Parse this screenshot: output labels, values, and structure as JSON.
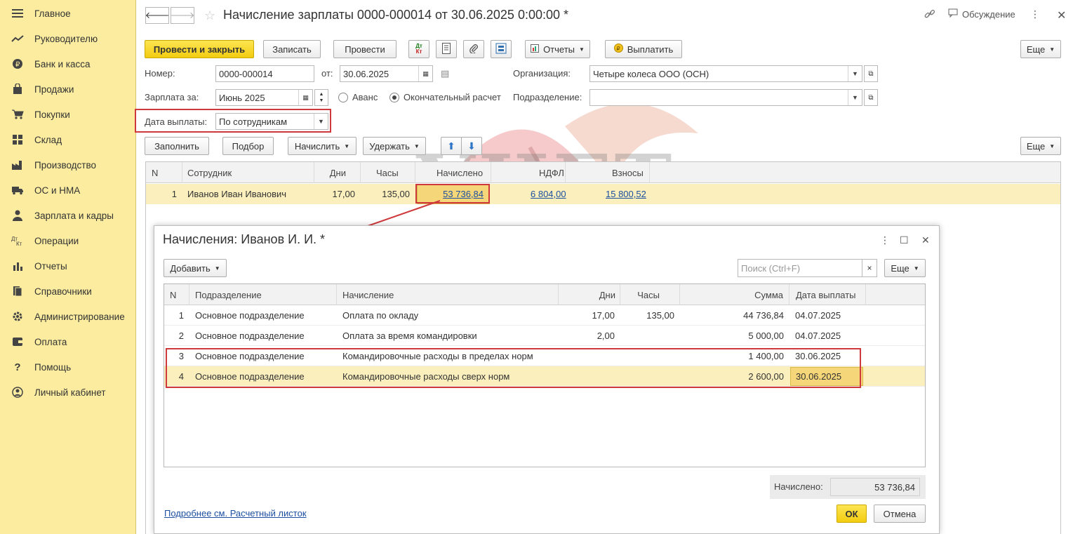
{
  "sidebar": {
    "items": [
      {
        "label": "Главное",
        "icon": "menu-icon"
      },
      {
        "label": "Руководителю",
        "icon": "trend-icon"
      },
      {
        "label": "Банк и касса",
        "icon": "coin-icon"
      },
      {
        "label": "Продажи",
        "icon": "bag-icon"
      },
      {
        "label": "Покупки",
        "icon": "cart-icon"
      },
      {
        "label": "Склад",
        "icon": "warehouse-icon"
      },
      {
        "label": "Производство",
        "icon": "factory-icon"
      },
      {
        "label": "ОС и НМА",
        "icon": "truck-icon"
      },
      {
        "label": "Зарплата и кадры",
        "icon": "person-icon"
      },
      {
        "label": "Операции",
        "icon": "dt-kt-icon"
      },
      {
        "label": "Отчеты",
        "icon": "bar-chart-icon"
      },
      {
        "label": "Справочники",
        "icon": "books-icon"
      },
      {
        "label": "Администрирование",
        "icon": "gear-icon"
      },
      {
        "label": "Оплата",
        "icon": "wallet-icon"
      },
      {
        "label": "Помощь",
        "icon": "question-icon"
      },
      {
        "label": "Личный кабинет",
        "icon": "user-circle-icon"
      }
    ]
  },
  "document": {
    "title": "Начисление зарплаты 0000-000014 от 30.06.2025 0:00:00 *",
    "discussion_label": "Обсуждение"
  },
  "toolbar": {
    "post_close": "Провести и закрыть",
    "save": "Записать",
    "post": "Провести",
    "dtkt_top": "Дт",
    "dtkt_bottom": "Кт",
    "reports": "Отчеты",
    "pay": "Выплатить",
    "more": "Еще"
  },
  "form": {
    "number_label": "Номер:",
    "number_value": "0000-000014",
    "from_label": "от:",
    "date_value": "30.06.2025",
    "org_label": "Организация:",
    "org_value": "Четыре колеса ООО (ОСН)",
    "salary_for_label": "Зарплата за:",
    "salary_for_value": "Июнь 2025",
    "advance_label": "Аванс",
    "final_label": "Окончательный расчет",
    "division_label": "Подразделение:",
    "division_value": "",
    "pay_date_label": "Дата выплаты:",
    "pay_date_value": "По сотрудникам"
  },
  "table_toolbar": {
    "fill": "Заполнить",
    "pick": "Подбор",
    "accrue": "Начислить",
    "withhold": "Удержать",
    "more": "Еще"
  },
  "main_table": {
    "columns": [
      "N",
      "Сотрудник",
      "Дни",
      "Часы",
      "Начислено",
      "НДФЛ",
      "Взносы"
    ],
    "rows": [
      {
        "n": "1",
        "employee": "Иванов Иван Иванович",
        "days": "17,00",
        "hours": "135,00",
        "accrued": "53 736,84",
        "ndfl": "6 804,00",
        "contrib": "15 800,52"
      }
    ]
  },
  "watermark": {
    "line1": "УЧЕТ",
    "line2": "БЕЗ ЗАБОТ"
  },
  "dialog": {
    "title": "Начисления: Иванов И. И. *",
    "add_button": "Добавить",
    "search_placeholder": "Поиск (Ctrl+F)",
    "more": "Еще",
    "columns": [
      "N",
      "Подразделение",
      "Начисление",
      "Дни",
      "Часы",
      "Сумма",
      "Дата выплаты"
    ],
    "rows": [
      {
        "n": "1",
        "division": "Основное подразделение",
        "accrual": "Оплата по окладу",
        "days": "17,00",
        "hours": "135,00",
        "sum": "44 736,84",
        "pay_date": "04.07.2025"
      },
      {
        "n": "2",
        "division": "Основное подразделение",
        "accrual": "Оплата за время командировки",
        "days": "2,00",
        "hours": "",
        "sum": "5 000,00",
        "pay_date": "04.07.2025"
      },
      {
        "n": "3",
        "division": "Основное подразделение",
        "accrual": "Командировочные расходы в пределах норм",
        "days": "",
        "hours": "",
        "sum": "1 400,00",
        "pay_date": "30.06.2025"
      },
      {
        "n": "4",
        "division": "Основное подразделение",
        "accrual": "Командировочные расходы сверх норм",
        "days": "",
        "hours": "",
        "sum": "2 600,00",
        "pay_date": "30.06.2025"
      }
    ],
    "total_label": "Начислено:",
    "total_value": "53 736,84",
    "payslip_link": "Подробнее см. Расчетный листок",
    "ok": "ОК",
    "cancel": "Отмена"
  }
}
